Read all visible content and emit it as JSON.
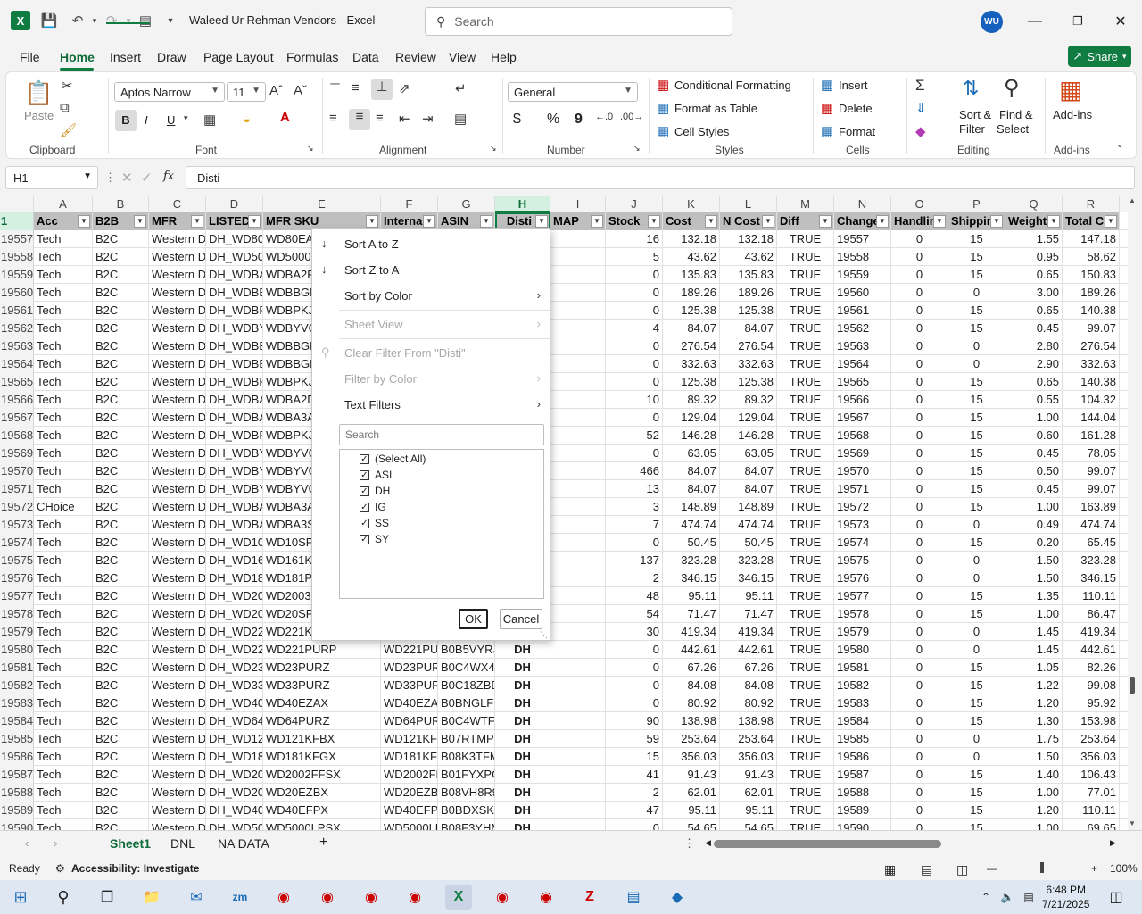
{
  "window": {
    "title": "Waleed Ur Rehman Vendors  -  Excel",
    "search_placeholder": "Search",
    "avatar_initials": "WU"
  },
  "menu_tabs": [
    "File",
    "Home",
    "Insert",
    "Draw",
    "Page Layout",
    "Formulas",
    "Data",
    "Review",
    "View",
    "Help"
  ],
  "share_label": "Share",
  "ribbon": {
    "clipboard": {
      "paste": "Paste",
      "label": "Clipboard"
    },
    "font": {
      "name": "Aptos Narrow",
      "size": "11",
      "label": "Font",
      "bold": "B",
      "italic": "I",
      "underline": "U"
    },
    "alignment": {
      "label": "Alignment"
    },
    "number": {
      "format": "General",
      "label": "Number",
      "currency": "$",
      "percent": "%",
      "comma": "9"
    },
    "styles": {
      "conditional": "Conditional Formatting",
      "format_table": "Format as Table",
      "cell_styles": "Cell Styles",
      "label": "Styles"
    },
    "cells": {
      "insert": "Insert",
      "delete": "Delete",
      "format": "Format",
      "label": "Cells"
    },
    "editing": {
      "sort_filter_1": "Sort &",
      "sort_filter_2": "Filter",
      "find_select_1": "Find &",
      "find_select_2": "Select",
      "label": "Editing"
    },
    "addins": {
      "btn": "Add-ins",
      "label": "Add-ins"
    }
  },
  "formula_bar": {
    "name_box": "H1",
    "fx": "fx",
    "value": "Disti"
  },
  "columns": [
    "A",
    "B",
    "C",
    "D",
    "E",
    "F",
    "G",
    "H",
    "I",
    "J",
    "K",
    "L",
    "M",
    "N",
    "O",
    "P",
    "Q",
    "R"
  ],
  "header_row": {
    "num": "1",
    "cells": [
      "Acc",
      "B2B",
      "MFR",
      "LISTED",
      "MFR SKU",
      "Interna",
      "ASIN",
      "Disti",
      "MAP",
      "Stock",
      "Cost",
      "N Cost",
      "Diff",
      "Change",
      "Handlin",
      "Shippin",
      "Weight",
      "Total C"
    ]
  },
  "rows": [
    {
      "n": "19557",
      "a": "Tech",
      "b": "B2C",
      "c": "Western D",
      "d": "DH_WD80",
      "e": "WD80EA",
      "f": "",
      "g": "",
      "h": "",
      "j": "16",
      "k": "132.18",
      "l": "132.18",
      "m": "TRUE",
      "o": "0",
      "p": "15",
      "q": "1.55",
      "r": "147.18"
    },
    {
      "n": "19558",
      "a": "Tech",
      "b": "B2C",
      "c": "Western D",
      "d": "DH_WD50",
      "e": "WD5000",
      "f": "",
      "g": "",
      "h": "",
      "j": "5",
      "k": "43.62",
      "l": "43.62",
      "m": "TRUE",
      "o": "0",
      "p": "15",
      "q": "0.95",
      "r": "58.62"
    },
    {
      "n": "19559",
      "a": "Tech",
      "b": "B2C",
      "c": "Western D",
      "d": "DH_WDBA",
      "e": "WDBA2F",
      "f": "",
      "g": "",
      "h": "",
      "j": "0",
      "k": "135.83",
      "l": "135.83",
      "m": "TRUE",
      "o": "0",
      "p": "15",
      "q": "0.65",
      "r": "150.83"
    },
    {
      "n": "19560",
      "a": "Tech",
      "b": "B2C",
      "c": "Western D",
      "d": "DH_WDBB",
      "e": "WDBBGE",
      "f": "",
      "g": "",
      "h": "",
      "j": "0",
      "k": "189.26",
      "l": "189.26",
      "m": "TRUE",
      "o": "0",
      "p": "0",
      "q": "3.00",
      "r": "189.26"
    },
    {
      "n": "19561",
      "a": "Tech",
      "b": "B2C",
      "c": "Western D",
      "d": "DH_WDBP",
      "e": "WDBPKJ",
      "f": "",
      "g": "",
      "h": "",
      "j": "0",
      "k": "125.38",
      "l": "125.38",
      "m": "TRUE",
      "o": "0",
      "p": "15",
      "q": "0.65",
      "r": "140.38"
    },
    {
      "n": "19562",
      "a": "Tech",
      "b": "B2C",
      "c": "Western D",
      "d": "DH_WDBY",
      "e": "WDBYVG",
      "f": "",
      "g": "",
      "h": "",
      "j": "4",
      "k": "84.07",
      "l": "84.07",
      "m": "TRUE",
      "o": "0",
      "p": "15",
      "q": "0.45",
      "r": "99.07"
    },
    {
      "n": "19563",
      "a": "Tech",
      "b": "B2C",
      "c": "Western D",
      "d": "DH_WDBB",
      "e": "WDBBGE",
      "f": "",
      "g": "",
      "h": "",
      "j": "0",
      "k": "276.54",
      "l": "276.54",
      "m": "TRUE",
      "o": "0",
      "p": "0",
      "q": "2.80",
      "r": "276.54"
    },
    {
      "n": "19564",
      "a": "Tech",
      "b": "B2C",
      "c": "Western D",
      "d": "DH_WDBB",
      "e": "WDBBGE",
      "f": "",
      "g": "",
      "h": "",
      "j": "0",
      "k": "332.63",
      "l": "332.63",
      "m": "TRUE",
      "o": "0",
      "p": "0",
      "q": "2.90",
      "r": "332.63"
    },
    {
      "n": "19565",
      "a": "Tech",
      "b": "B2C",
      "c": "Western D",
      "d": "DH_WDBP",
      "e": "WDBPKJ",
      "f": "",
      "g": "",
      "h": "",
      "j": "0",
      "k": "125.38",
      "l": "125.38",
      "m": "TRUE",
      "o": "0",
      "p": "15",
      "q": "0.65",
      "r": "140.38"
    },
    {
      "n": "19566",
      "a": "Tech",
      "b": "B2C",
      "c": "Western D",
      "d": "DH_WDBA",
      "e": "WDBA2D",
      "f": "",
      "g": "",
      "h": "",
      "j": "10",
      "k": "89.32",
      "l": "89.32",
      "m": "TRUE",
      "o": "0",
      "p": "15",
      "q": "0.55",
      "r": "104.32"
    },
    {
      "n": "19567",
      "a": "Tech",
      "b": "B2C",
      "c": "Western D",
      "d": "DH_WDBA",
      "e": "WDBA3A",
      "f": "",
      "g": "",
      "h": "",
      "j": "0",
      "k": "129.04",
      "l": "129.04",
      "m": "TRUE",
      "o": "0",
      "p": "15",
      "q": "1.00",
      "r": "144.04"
    },
    {
      "n": "19568",
      "a": "Tech",
      "b": "B2C",
      "c": "Western D",
      "d": "DH_WDBP",
      "e": "WDBPKJ",
      "f": "",
      "g": "",
      "h": "",
      "j": "52",
      "k": "146.28",
      "l": "146.28",
      "m": "TRUE",
      "o": "0",
      "p": "15",
      "q": "0.60",
      "r": "161.28"
    },
    {
      "n": "19569",
      "a": "Tech",
      "b": "B2C",
      "c": "Western D",
      "d": "DH_WDBY",
      "e": "WDBYVG",
      "f": "",
      "g": "",
      "h": "",
      "j": "0",
      "k": "63.05",
      "l": "63.05",
      "m": "TRUE",
      "o": "0",
      "p": "15",
      "q": "0.45",
      "r": "78.05"
    },
    {
      "n": "19570",
      "a": "Tech",
      "b": "B2C",
      "c": "Western D",
      "d": "DH_WDBY",
      "e": "WDBYVG",
      "f": "",
      "g": "",
      "h": "",
      "j": "466",
      "k": "84.07",
      "l": "84.07",
      "m": "TRUE",
      "o": "0",
      "p": "15",
      "q": "0.50",
      "r": "99.07"
    },
    {
      "n": "19571",
      "a": "Tech",
      "b": "B2C",
      "c": "Western D",
      "d": "DH_WDBY",
      "e": "WDBYVG",
      "f": "",
      "g": "",
      "h": "",
      "j": "13",
      "k": "84.07",
      "l": "84.07",
      "m": "TRUE",
      "o": "0",
      "p": "15",
      "q": "0.45",
      "r": "99.07"
    },
    {
      "n": "19572",
      "a": "CHoice",
      "b": "B2C",
      "c": "Western D",
      "d": "DH_WDBA",
      "e": "WDBA3A",
      "f": "",
      "g": "",
      "h": "",
      "j": "3",
      "k": "148.89",
      "l": "148.89",
      "m": "TRUE",
      "o": "0",
      "p": "15",
      "q": "1.00",
      "r": "163.89"
    },
    {
      "n": "19573",
      "a": "Tech",
      "b": "B2C",
      "c": "Western D",
      "d": "DH_WDBA",
      "e": "WDBA3S",
      "f": "",
      "g": "",
      "h": "",
      "j": "7",
      "k": "474.74",
      "l": "474.74",
      "m": "TRUE",
      "o": "0",
      "p": "0",
      "q": "0.49",
      "r": "474.74"
    },
    {
      "n": "19574",
      "a": "Tech",
      "b": "B2C",
      "c": "Western D",
      "d": "DH_WD10",
      "e": "WD10SP",
      "f": "",
      "g": "",
      "h": "",
      "j": "0",
      "k": "50.45",
      "l": "50.45",
      "m": "TRUE",
      "o": "0",
      "p": "15",
      "q": "0.20",
      "r": "65.45"
    },
    {
      "n": "19575",
      "a": "Tech",
      "b": "B2C",
      "c": "Western D",
      "d": "DH_WD16",
      "e": "WD161K",
      "f": "",
      "g": "",
      "h": "",
      "j": "137",
      "k": "323.28",
      "l": "323.28",
      "m": "TRUE",
      "o": "0",
      "p": "0",
      "q": "1.50",
      "r": "323.28"
    },
    {
      "n": "19576",
      "a": "Tech",
      "b": "B2C",
      "c": "Western D",
      "d": "DH_WD18",
      "e": "WD181P",
      "f": "",
      "g": "",
      "h": "",
      "j": "2",
      "k": "346.15",
      "l": "346.15",
      "m": "TRUE",
      "o": "0",
      "p": "0",
      "q": "1.50",
      "r": "346.15"
    },
    {
      "n": "19577",
      "a": "Tech",
      "b": "B2C",
      "c": "Western D",
      "d": "DH_WD20",
      "e": "WD2003",
      "f": "",
      "g": "",
      "h": "",
      "j": "48",
      "k": "95.11",
      "l": "95.11",
      "m": "TRUE",
      "o": "0",
      "p": "15",
      "q": "1.35",
      "r": "110.11"
    },
    {
      "n": "19578",
      "a": "Tech",
      "b": "B2C",
      "c": "Western D",
      "d": "DH_WD20",
      "e": "WD20SP",
      "f": "",
      "g": "",
      "h": "",
      "j": "54",
      "k": "71.47",
      "l": "71.47",
      "m": "TRUE",
      "o": "0",
      "p": "15",
      "q": "1.00",
      "r": "86.47"
    },
    {
      "n": "19579",
      "a": "Tech",
      "b": "B2C",
      "c": "Western D",
      "d": "DH_WD22",
      "e": "WD221K",
      "f": "",
      "g": "",
      "h": "",
      "j": "30",
      "k": "419.34",
      "l": "419.34",
      "m": "TRUE",
      "o": "0",
      "p": "0",
      "q": "1.45",
      "r": "419.34"
    },
    {
      "n": "19580",
      "a": "Tech",
      "b": "B2C",
      "c": "Western D",
      "d": "DH_WD22",
      "e": "WD221PURP",
      "f": "WD221PU",
      "g": "B0B5VYRJ",
      "h": "DH",
      "j": "0",
      "k": "442.61",
      "l": "442.61",
      "m": "TRUE",
      "o": "0",
      "p": "0",
      "q": "1.45",
      "r": "442.61"
    },
    {
      "n": "19581",
      "a": "Tech",
      "b": "B2C",
      "c": "Western D",
      "d": "DH_WD23",
      "e": "WD23PURZ",
      "f": "WD23PUR",
      "g": "B0C4WX4Y",
      "h": "DH",
      "j": "0",
      "k": "67.26",
      "l": "67.26",
      "m": "TRUE",
      "o": "0",
      "p": "15",
      "q": "1.05",
      "r": "82.26"
    },
    {
      "n": "19582",
      "a": "Tech",
      "b": "B2C",
      "c": "Western D",
      "d": "DH_WD33",
      "e": "WD33PURZ",
      "f": "WD33PUR",
      "g": "B0C18ZBD",
      "h": "DH",
      "j": "0",
      "k": "84.08",
      "l": "84.08",
      "m": "TRUE",
      "o": "0",
      "p": "15",
      "q": "1.22",
      "r": "99.08"
    },
    {
      "n": "19583",
      "a": "Tech",
      "b": "B2C",
      "c": "Western D",
      "d": "DH_WD40",
      "e": "WD40EZAX",
      "f": "WD40EZA",
      "g": "B0BNGLFE",
      "h": "DH",
      "j": "0",
      "k": "80.92",
      "l": "80.92",
      "m": "TRUE",
      "o": "0",
      "p": "15",
      "q": "1.20",
      "r": "95.92"
    },
    {
      "n": "19584",
      "a": "Tech",
      "b": "B2C",
      "c": "Western D",
      "d": "DH_WD64",
      "e": "WD64PURZ",
      "f": "WD64PUR",
      "g": "B0C4WTF5",
      "h": "DH",
      "j": "90",
      "k": "138.98",
      "l": "138.98",
      "m": "TRUE",
      "o": "0",
      "p": "15",
      "q": "1.30",
      "r": "153.98"
    },
    {
      "n": "19585",
      "a": "Tech",
      "b": "B2C",
      "c": "Western D",
      "d": "DH_WD12",
      "e": "WD121KFBX",
      "f": "WD121KFE",
      "g": "B07RTMPV",
      "h": "DH",
      "j": "59",
      "k": "253.64",
      "l": "253.64",
      "m": "TRUE",
      "o": "0",
      "p": "0",
      "q": "1.75",
      "r": "253.64"
    },
    {
      "n": "19586",
      "a": "Tech",
      "b": "B2C",
      "c": "Western D",
      "d": "DH_WD18",
      "e": "WD181KFGX",
      "f": "WD181KFC",
      "g": "B08K3TFM",
      "h": "DH",
      "j": "15",
      "k": "356.03",
      "l": "356.03",
      "m": "TRUE",
      "o": "0",
      "p": "0",
      "q": "1.50",
      "r": "356.03"
    },
    {
      "n": "19587",
      "a": "Tech",
      "b": "B2C",
      "c": "Western D",
      "d": "DH_WD20",
      "e": "WD2002FFSX",
      "f": "WD2002FF",
      "g": "B01FYXPG",
      "h": "DH",
      "j": "41",
      "k": "91.43",
      "l": "91.43",
      "m": "TRUE",
      "o": "0",
      "p": "15",
      "q": "1.40",
      "r": "106.43"
    },
    {
      "n": "19588",
      "a": "Tech",
      "b": "B2C",
      "c": "Western D",
      "d": "DH_WD20",
      "e": "WD20EZBX",
      "f": "WD20EZB",
      "g": "B08VH8R9",
      "h": "DH",
      "j": "2",
      "k": "62.01",
      "l": "62.01",
      "m": "TRUE",
      "o": "0",
      "p": "15",
      "q": "1.00",
      "r": "77.01"
    },
    {
      "n": "19589",
      "a": "Tech",
      "b": "B2C",
      "c": "Western D",
      "d": "DH_WD40",
      "e": "WD40EFPX",
      "f": "WD40EFP",
      "g": "B0BDXSK2",
      "h": "DH",
      "j": "47",
      "k": "95.11",
      "l": "95.11",
      "m": "TRUE",
      "o": "0",
      "p": "15",
      "q": "1.20",
      "r": "110.11"
    },
    {
      "n": "19590",
      "a": "Tech",
      "b": "B2C",
      "c": "Western D",
      "d": "DH_WD50",
      "e": "WD5000LPSX",
      "f": "WD5000LF",
      "g": "B08F3YHM",
      "h": "DH",
      "j": "0",
      "k": "54.65",
      "l": "54.65",
      "m": "TRUE",
      "o": "0",
      "p": "15",
      "q": "1.00",
      "r": "69.65"
    }
  ],
  "filter_menu": {
    "sort_az": "Sort A to Z",
    "sort_za": "Sort Z to A",
    "sort_color": "Sort by Color",
    "sheet_view": "Sheet View",
    "clear_filter": "Clear Filter From \"Disti\"",
    "filter_color": "Filter by Color",
    "text_filters": "Text Filters",
    "search_placeholder": "Search",
    "items": [
      "(Select All)",
      "ASI",
      "DH",
      "IG",
      "SS",
      "SY"
    ],
    "ok": "OK",
    "cancel": "Cancel"
  },
  "sheets": [
    "Sheet1",
    "DNL",
    "NA DATA"
  ],
  "status": {
    "ready": "Ready",
    "accessibility": "Accessibility: Investigate",
    "zoom": "100%"
  },
  "clock": {
    "time": "6:48 PM",
    "date": "7/21/2025"
  }
}
